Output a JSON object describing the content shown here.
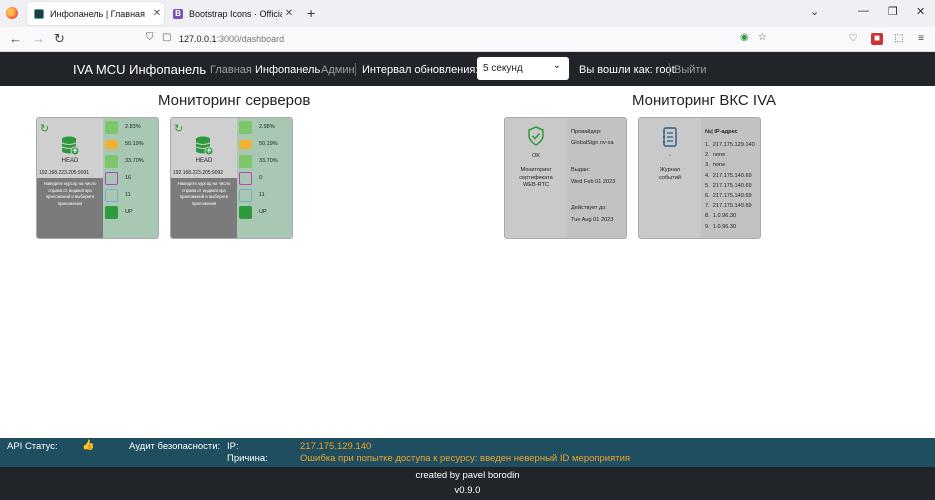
{
  "browser": {
    "tabs": [
      {
        "title": "Инфопанель | Главная",
        "active": true
      },
      {
        "title": "Bootstrap Icons · Official open source SVG icon library for Bootstrap",
        "active": false
      }
    ],
    "url": {
      "host": "127.0.0.1",
      "path": ":3000/dashboard"
    }
  },
  "nav": {
    "brand": "IVA MCU Инфопанель",
    "links": [
      "Главная",
      "Инфопанель",
      "Админ"
    ],
    "interval_label": "Интервал обновления:",
    "interval_value": "5 секунд",
    "user_label": "Вы вошли как: root",
    "logout": "Выйти"
  },
  "servers": {
    "title": "Мониторинг серверов",
    "hint": "Наведите курсор на число справа от индикатора приложений и выберите приложения",
    "items": [
      {
        "role": "HEAD",
        "ip": "192.168.223.205:9091",
        "cpu": "2.83%",
        "mem": "50.19%",
        "disk": "33.70%",
        "apps": "16",
        "sessions": "11",
        "net": "UP"
      },
      {
        "role": "HEAD",
        "ip": "192.168.223.205:9092",
        "cpu": "2.98%",
        "mem": "50.19%",
        "disk": "33.70%",
        "apps": "0",
        "sessions": "11",
        "net": "UP"
      }
    ]
  },
  "vks": {
    "title": "Мониторинг ВКС IVA",
    "cert": {
      "status": "OK",
      "name": "Мониторинг сертификата WEB-RTC",
      "provider_label": "Провайдер:",
      "provider": "GlobalSign nv-sa",
      "issued_label": "Выдан:",
      "issued": "Wed Feb 01 2023",
      "valid_label": "Действует до:",
      "valid": "Tue Aug 01 2023"
    },
    "journal": {
      "dash": "-",
      "name": "Журнал событий",
      "header": "№| IP-адрес",
      "entries": [
        "217.175.129.140",
        "none",
        "none",
        "217.175.140.69",
        "217.175.140.69",
        "217.175.140.69",
        "217.175.140.69",
        "1.0.96.30",
        "1.0.96.30"
      ]
    }
  },
  "status": {
    "api_label": "API Статус:",
    "audit_label": "Аудит безопасности:",
    "ip_label": "IP:",
    "ip_value": "217.175.129.140",
    "reason_label": "Причина:",
    "reason_value": "Ошибка при попытке доступа к ресурсу: введен неверный ID мероприятия"
  },
  "footer": {
    "credit": "created by pavel borodin",
    "version": "v0.9.0"
  },
  "colors": {
    "navbar": "#212529",
    "statusbar": "#1e4e5f",
    "amber": "#f0a52a",
    "green": "#2e9a3e"
  }
}
